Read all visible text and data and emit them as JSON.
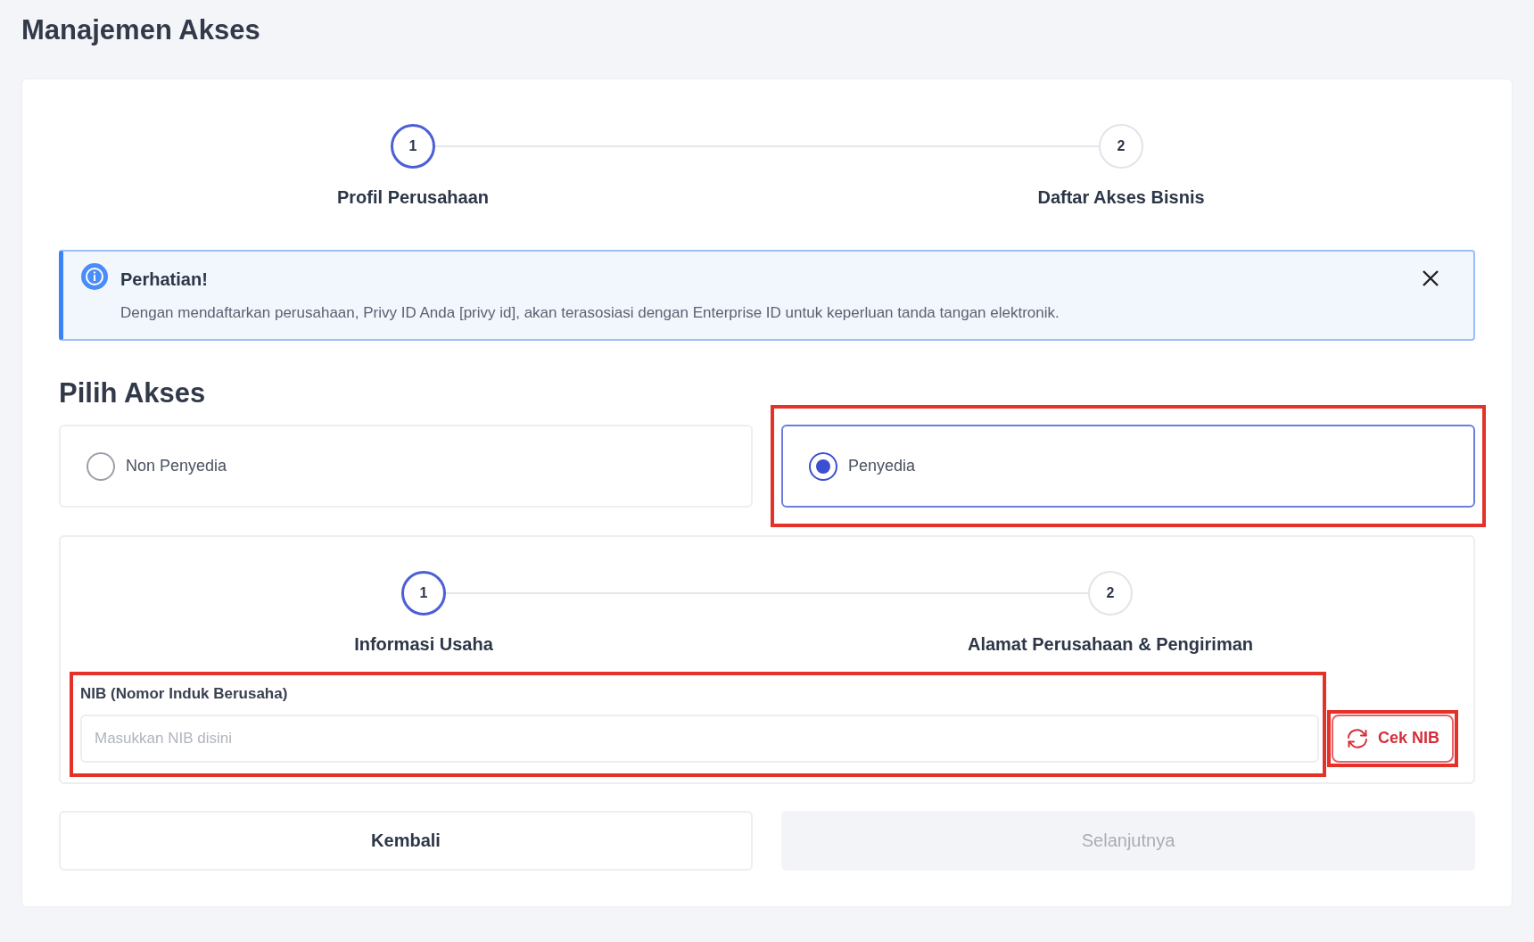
{
  "page_title": "Manajemen Akses",
  "steps": [
    {
      "number": "1",
      "label": "Profil Perusahaan",
      "active": true
    },
    {
      "number": "2",
      "label": "Daftar Akses Bisnis",
      "active": false
    }
  ],
  "alert": {
    "title": "Perhatian!",
    "message": "Dengan mendaftarkan perusahaan, Privy ID Anda [privy id], akan terasosiasi dengan Enterprise ID untuk keperluan tanda tangan elektronik."
  },
  "section_title": "Pilih Akses",
  "options": [
    {
      "label": "Non Penyedia",
      "selected": false,
      "highlighted": false
    },
    {
      "label": "Penyedia",
      "selected": true,
      "highlighted": true
    }
  ],
  "sub_steps": [
    {
      "number": "1",
      "label": "Informasi Usaha",
      "active": true
    },
    {
      "number": "2",
      "label": "Alamat Perusahaan & Pengiriman",
      "active": false
    }
  ],
  "nib_field": {
    "label": "NIB (Nomor Induk Berusaha)",
    "placeholder": "Masukkan NIB disini",
    "highlighted": true
  },
  "check_button": {
    "label": "Cek NIB",
    "highlighted": true
  },
  "buttons": [
    {
      "label": "Kembali",
      "disabled": false
    },
    {
      "label": "Selanjutnya",
      "disabled": true
    }
  ]
}
